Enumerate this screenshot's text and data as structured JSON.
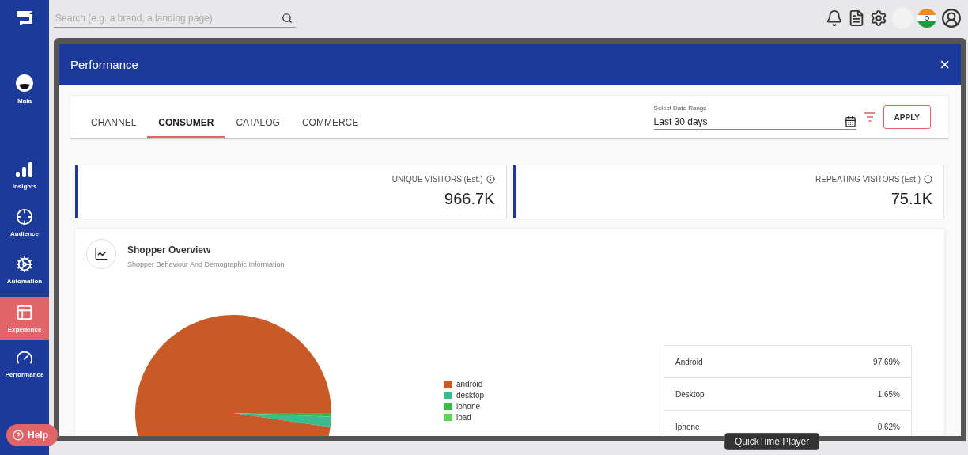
{
  "sidebar": {
    "items": [
      {
        "label": "Maia",
        "selected": false
      },
      {
        "label": "Insights",
        "selected": false
      },
      {
        "label": "Audience",
        "selected": false
      },
      {
        "label": "Automation",
        "selected": false
      },
      {
        "label": "Experience",
        "selected": true
      },
      {
        "label": "Performance",
        "selected": false
      }
    ],
    "help": "Help"
  },
  "topbar": {
    "search": {
      "placeholder": "Search (e.g. a brand, a landing page)"
    }
  },
  "modal": {
    "title": "Performance",
    "close": "×",
    "tabs": [
      {
        "label": "CHANNEL",
        "selected": false
      },
      {
        "label": "CONSUMER",
        "selected": true
      },
      {
        "label": "CATALOG",
        "selected": false
      },
      {
        "label": "COMMERCE",
        "selected": false
      }
    ],
    "date_range": {
      "label": "Select Date Range",
      "value": "Last 30 days"
    },
    "apply": "APPLY",
    "stats": [
      {
        "label": "UNIQUE VISITORS (Est.)",
        "value": "966.7K"
      },
      {
        "label": "REPEATING VISITORS (Est.)",
        "value": "75.1K"
      }
    ],
    "overview": {
      "title": "Shopper Overview",
      "subtitle": "Shopper Behaviour And Demographic Information",
      "chart_data": {
        "type": "pie",
        "categories": [
          "android",
          "desktop",
          "iphone",
          "ipad"
        ],
        "values": [
          97.69,
          1.65,
          0.62,
          null
        ]
      },
      "legend": [
        {
          "color": "#c85a28"
        },
        {
          "color": "#3dbb8e"
        },
        {
          "color": "#3cb84a"
        },
        {
          "color": "#5ad65a"
        }
      ],
      "table": [
        {
          "label": "Android",
          "value": "97.69%"
        },
        {
          "label": "Desktop",
          "value": "1.65%"
        },
        {
          "label": "Iphone",
          "value": "0.62%"
        }
      ]
    }
  },
  "tooltip": "QuickTime Player"
}
